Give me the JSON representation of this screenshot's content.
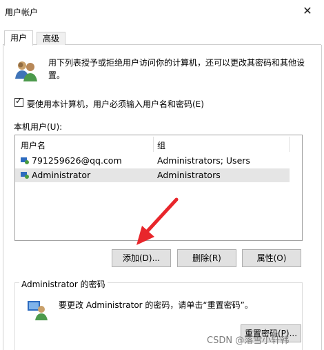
{
  "window": {
    "title": "用户帐户",
    "close_icon": "close-icon"
  },
  "tabs": [
    {
      "label": "用户"
    },
    {
      "label": "高级"
    }
  ],
  "description": "用下列表授予或拒绝用户访问你的计算机，还可以更改其密码和其他设置。",
  "require_login": {
    "checked": true,
    "label": "要使用本计算机，用户必须输入用户名和密码(E)"
  },
  "local_users": {
    "label": "本机用户(U):",
    "columns": [
      "用户名",
      "组"
    ],
    "rows": [
      {
        "name": "791259626@qq.com",
        "group": "Administrators; Users",
        "selected": false
      },
      {
        "name": "Administrator",
        "group": "Administrators",
        "selected": true
      }
    ]
  },
  "buttons": {
    "add": "添加(D)...",
    "remove": "删除(R)",
    "properties": "属性(O)"
  },
  "password": {
    "group_title": "Administrator 的密码",
    "text": "要更改 Administrator 的密码，请单击“重置密码”。",
    "reset_button": "重置密码(P)..."
  },
  "watermark": "CSDN @落雪小轩韩",
  "colors": {
    "arrow": "#e8262b",
    "selection": "#e5e5e5",
    "button_face": "#e1e1e1"
  }
}
